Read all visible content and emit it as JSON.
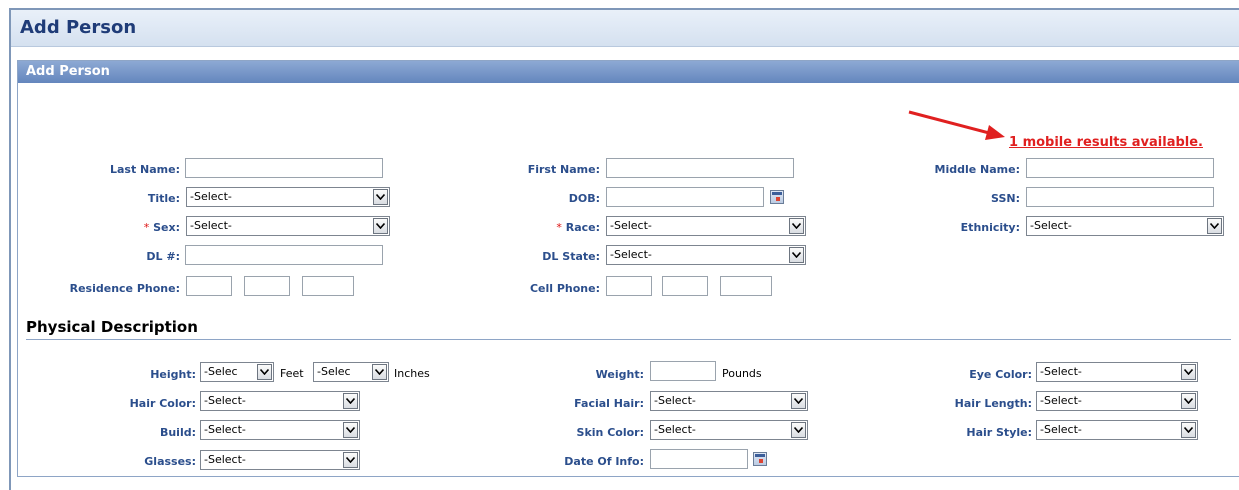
{
  "page": {
    "title": "Add Person"
  },
  "panel": {
    "title": "Add Person"
  },
  "mobile_link": "1 mobile results available.",
  "colors": {
    "accent": "#2b4e8c",
    "required": "#d11111",
    "link": "#e02020",
    "panel_header": "#6486bd"
  },
  "person": {
    "last_name_label": "Last Name:",
    "first_name_label": "First Name:",
    "middle_name_label": "Middle Name:",
    "title_label": "Title:",
    "title_value": "-Select-",
    "dob_label": "DOB:",
    "ssn_label": "SSN:",
    "required_mark": "*",
    "sex_label": "Sex:",
    "sex_value": "-Select-",
    "race_label": "Race:",
    "race_value": "-Select-",
    "ethnicity_label": "Ethnicity:",
    "ethnicity_value": "-Select-",
    "dl_label": "DL #:",
    "dl_state_label": "DL State:",
    "dl_state_value": "-Select-",
    "residence_phone_label": "Residence Phone:",
    "cell_phone_label": "Cell Phone:"
  },
  "physical": {
    "section_title": "Physical Description",
    "height_label": "Height:",
    "height_feet_value": "-Selec",
    "feet_unit": "Feet",
    "height_inches_value": "-Selec",
    "inches_unit": "Inches",
    "weight_label": "Weight:",
    "pounds_unit": "Pounds",
    "eye_color_label": "Eye Color:",
    "eye_color_value": "-Select-",
    "hair_color_label": "Hair Color:",
    "hair_color_value": "-Select-",
    "facial_hair_label": "Facial Hair:",
    "facial_hair_value": "-Select-",
    "hair_length_label": "Hair Length:",
    "hair_length_value": "-Select-",
    "build_label": "Build:",
    "build_value": "-Select-",
    "skin_color_label": "Skin Color:",
    "skin_color_value": "-Select-",
    "hair_style_label": "Hair Style:",
    "hair_style_value": "-Select-",
    "glasses_label": "Glasses:",
    "glasses_value": "-Select-",
    "date_of_info_label": "Date Of Info:"
  }
}
